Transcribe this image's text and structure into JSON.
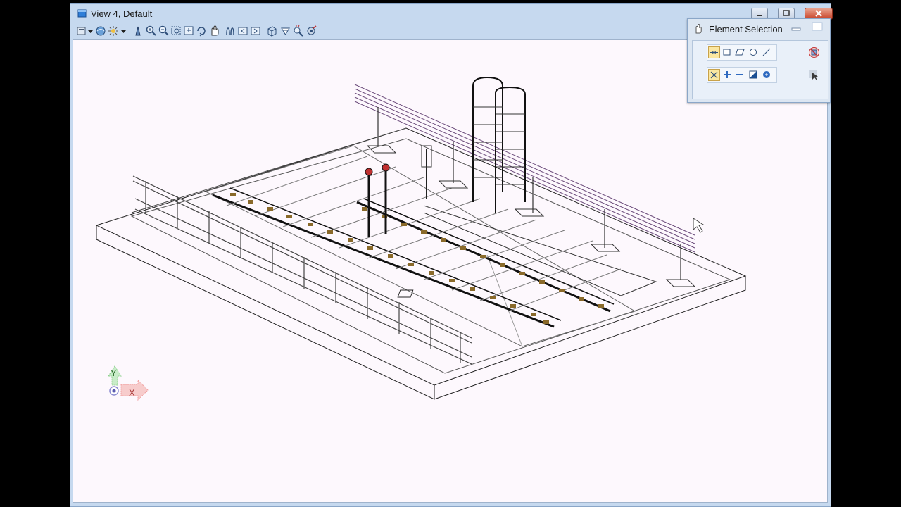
{
  "window": {
    "title": "View 4, Default",
    "icon": "view-window-icon",
    "controls": [
      "minimize-icon",
      "maximize-icon",
      "close-icon"
    ]
  },
  "view_toolbar": {
    "tools": [
      "view-attributes-icon",
      "dropdown-arrow-icon",
      "render-mode-icon",
      "display-style-icon",
      "dropdown-arrow-icon",
      "update-view-icon",
      "zoom-in-icon",
      "zoom-out-icon",
      "window-area-icon",
      "fit-view-icon",
      "rotate-view-icon",
      "pan-view-icon",
      "walk-icon",
      "view-previous-icon",
      "view-next-icon",
      "clip-volume-icon",
      "view-toggles-icon",
      "camera-icon",
      "settings-icon"
    ]
  },
  "viewport": {
    "background": "#fdf8fd",
    "axis_triad": {
      "y_label": "Y",
      "x_label": "X",
      "y_color": "#8fd08f",
      "x_color": "#f0a0a0"
    }
  },
  "element_selection": {
    "title": "Element Selection",
    "icon": "hand-select-icon",
    "row1": [
      "individual-selection-icon",
      "block-selection-icon",
      "shape-selection-icon",
      "circle-selection-icon",
      "line-selection-icon"
    ],
    "row2": [
      "new-selection-icon",
      "add-to-selection-icon",
      "subtract-from-selection-icon",
      "invert-selection-icon",
      "clear-selection-icon"
    ],
    "side": [
      "deselect-all-icon",
      "select-all-icon"
    ],
    "accent": "#fbe7a1"
  }
}
